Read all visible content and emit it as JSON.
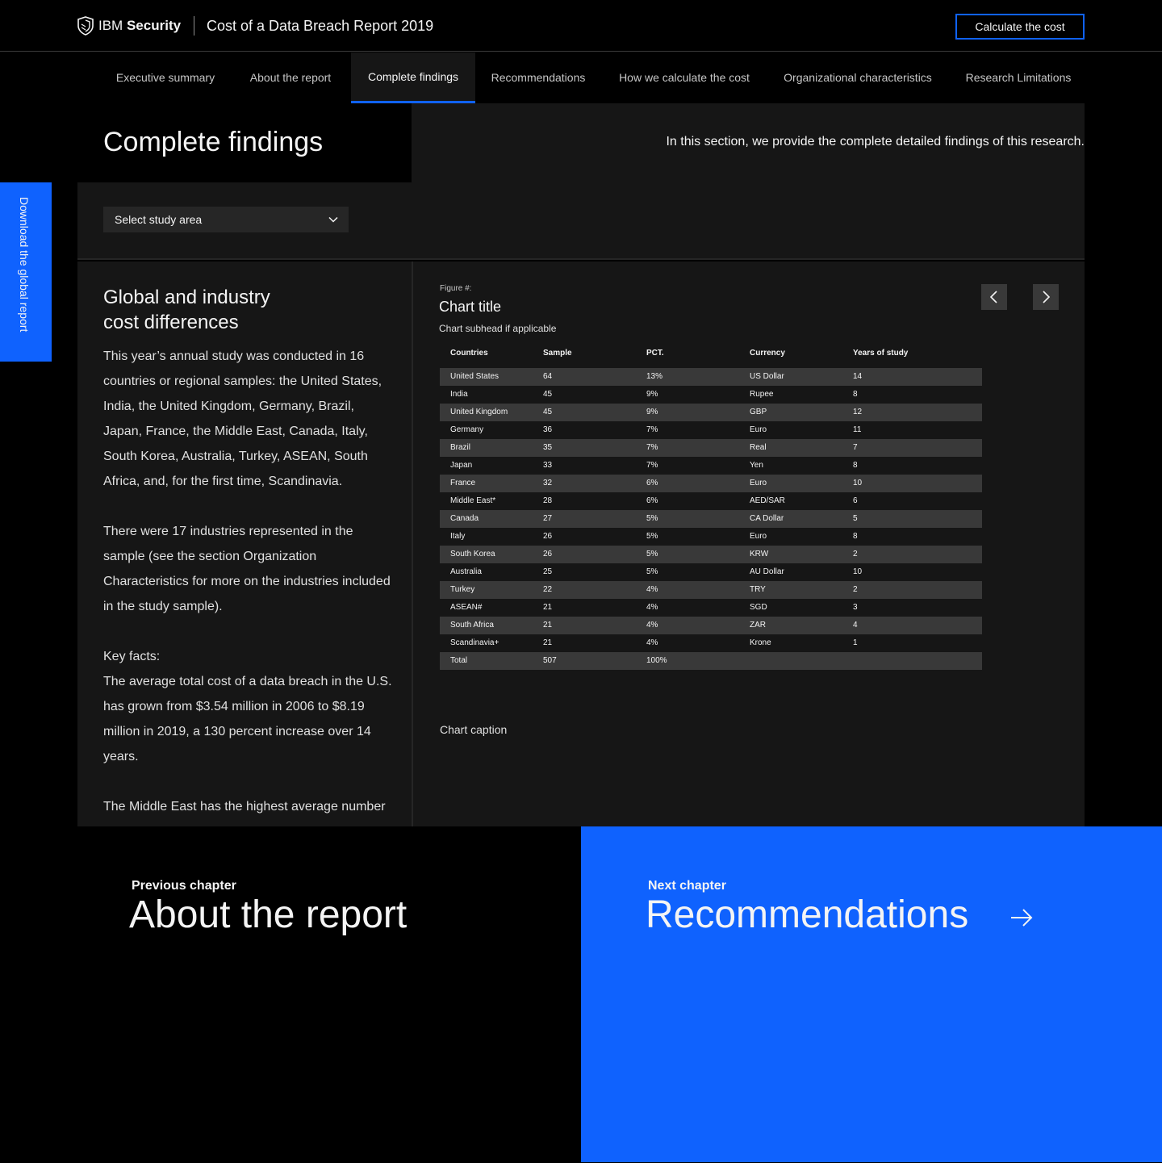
{
  "header": {
    "brand_ibm": "IBM",
    "brand_security": "Security",
    "report_title": "Cost of a Data Breach Report 2019",
    "cta_label": "Calculate the cost",
    "logo_icon": "shield-logo-icon"
  },
  "nav": {
    "tabs": [
      {
        "label": "Executive summary"
      },
      {
        "label": "About the report"
      },
      {
        "label": "Complete findings",
        "active": true
      },
      {
        "label": "Recommendations"
      },
      {
        "label": "How we calculate the cost"
      },
      {
        "label": "Organizational characteristics"
      },
      {
        "label": "Research Limitations"
      }
    ]
  },
  "section": {
    "title": "Complete findings",
    "description": "In this section, we provide the complete detailed findings of this research."
  },
  "side_tab": {
    "label": "Download the global report"
  },
  "filter": {
    "select_label": "Select study area",
    "chevron_icon": "chevron-down-icon"
  },
  "text_panel": {
    "heading_line1": "Global and industry",
    "heading_line2": "cost differences",
    "p1": "This year’s annual study was conducted in 16 countries or regional samples: the United States, India, the United Kingdom, Germany, Brazil, Japan, France, the Middle East, Canada, Italy, South Korea, Australia, Turkey, ASEAN, South Africa, and, for the first time, Scandinavia.",
    "p2": "There were 17 industries represented in the sample (see the section Organization Characteristics for more on the industries included in the study sample).",
    "p3": "Key facts:",
    "p4": "The average total cost of a data breach in the U.S. has grown from $3.54 million in 2006 to $8.19 million in 2019, a 130 percent increase over 14 years.",
    "p5": "The Middle East has the highest average number"
  },
  "chart": {
    "figure_label": "Figure #:",
    "title": "Chart title",
    "subhead": "Chart subhead if applicable",
    "caption": "Chart caption",
    "prev_icon": "chevron-left-icon",
    "next_icon": "chevron-right-icon"
  },
  "chart_data": {
    "type": "table",
    "columns": [
      "Countries",
      "Sample",
      "PCT.",
      "Currency",
      "Years of study"
    ],
    "rows": [
      [
        "United States",
        "64",
        "13%",
        "US Dollar",
        "14"
      ],
      [
        "India",
        "45",
        "9%",
        "Rupee",
        "8"
      ],
      [
        "United Kingdom",
        "45",
        "9%",
        "GBP",
        "12"
      ],
      [
        "Germany",
        "36",
        "7%",
        "Euro",
        "11"
      ],
      [
        "Brazil",
        "35",
        "7%",
        "Real",
        "7"
      ],
      [
        "Japan",
        "33",
        "7%",
        "Yen",
        "8"
      ],
      [
        "France",
        "32",
        "6%",
        "Euro",
        "10"
      ],
      [
        "Middle East*",
        "28",
        "6%",
        "AED/SAR",
        "6"
      ],
      [
        "Canada",
        "27",
        "5%",
        "CA Dollar",
        "5"
      ],
      [
        "Italy",
        "26",
        "5%",
        "Euro",
        "8"
      ],
      [
        "South Korea",
        "26",
        "5%",
        "KRW",
        "2"
      ],
      [
        "Australia",
        "25",
        "5%",
        "AU Dollar",
        "10"
      ],
      [
        "Turkey",
        "22",
        "4%",
        "TRY",
        "2"
      ],
      [
        "ASEAN#",
        "21",
        "4%",
        "SGD",
        "3"
      ],
      [
        "South Africa",
        "21",
        "4%",
        "ZAR",
        "4"
      ],
      [
        "Scandinavia+",
        "21",
        "4%",
        "Krone",
        "1"
      ],
      [
        "Total",
        "507",
        "100%",
        "",
        ""
      ]
    ]
  },
  "chapters": {
    "previous": {
      "kicker": "Previous chapter",
      "title": "About the report"
    },
    "next": {
      "kicker": "Next chapter",
      "title": "Recommendations",
      "icon": "arrow-right-icon"
    }
  },
  "colors": {
    "accent": "#0f62fe",
    "background": "#000000",
    "panel": "#161616",
    "row_stripe": "#393939"
  }
}
